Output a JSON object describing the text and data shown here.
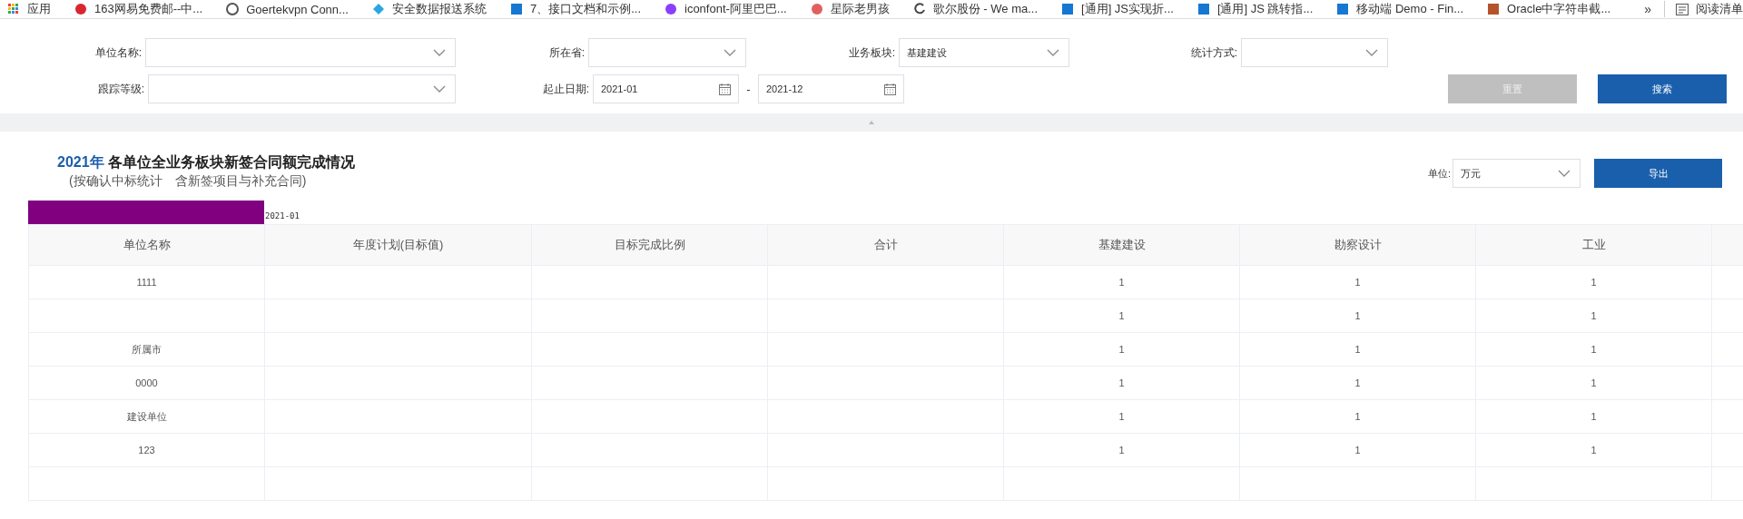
{
  "bookmarks_bar": {
    "items": [
      {
        "label": "应用"
      },
      {
        "label": "163网易免费邮--中..."
      },
      {
        "label": "Goertekvpn Conn..."
      },
      {
        "label": "安全数据报送系统"
      },
      {
        "label": "7、接口文档和示例..."
      },
      {
        "label": "iconfont-阿里巴巴..."
      },
      {
        "label": "星际老男孩"
      },
      {
        "label": "歌尔股份 - We ma..."
      },
      {
        "label": "[通用] JS实现折..."
      },
      {
        "label": "[通用] JS 跳转指..."
      },
      {
        "label": "移动端 Demo - Fin..."
      },
      {
        "label": "Oracle中字符串截..."
      }
    ],
    "overflow": "»",
    "reading_list": "阅读清单"
  },
  "filters": {
    "row_1": [
      {
        "kind": "select",
        "label": "单位名称:"
      },
      {
        "kind": "select",
        "label": "所在省:"
      },
      {
        "kind": "select",
        "label": "业务板块:",
        "value": "基建建设"
      },
      {
        "kind": "select",
        "label": "统计方式:"
      }
    ],
    "row_2": [
      {
        "kind": "select",
        "label": "跟踪等级:"
      },
      {
        "kind": "date_range",
        "label": "起止日期:",
        "start": "2021-01",
        "separator": "-",
        "end": "2021-12"
      }
    ],
    "buttons": [
      {
        "kind": "secondary",
        "label": "重置"
      },
      {
        "kind": "primary",
        "label": "搜索"
      }
    ]
  },
  "report": {
    "title_year": "2021年",
    "title": "各单位全业务板块新签合同额完成情况",
    "subtitle": "(按确认中标统计　含新签项目与补充合同)",
    "unit_select": {
      "label": "单位:",
      "value": "万元"
    },
    "export_button": "导出",
    "period": "2021-01"
  },
  "table": {
    "columns": [
      "单位名称",
      "年度计划(目标值)",
      "目标完成比例",
      "合计",
      "基建建设",
      "勘察设计",
      "工业"
    ],
    "rows": [
      {
        "unit_name": "1111",
        "infrastructure": "1",
        "survey_design": "1",
        "industry": "1"
      },
      {
        "infrastructure": "1",
        "survey_design": "1",
        "industry": "1"
      },
      {
        "unit_name": "所属市",
        "infrastructure": "1",
        "survey_design": "1",
        "industry": "1"
      },
      {
        "unit_name": "0000",
        "infrastructure": "1",
        "survey_design": "1",
        "industry": "1"
      },
      {
        "unit_name": "建设单位",
        "infrastructure": "1",
        "survey_design": "1",
        "industry": "1"
      },
      {
        "unit_name": "123",
        "infrastructure": "1",
        "survey_design": "1",
        "industry": "1"
      }
    ]
  }
}
